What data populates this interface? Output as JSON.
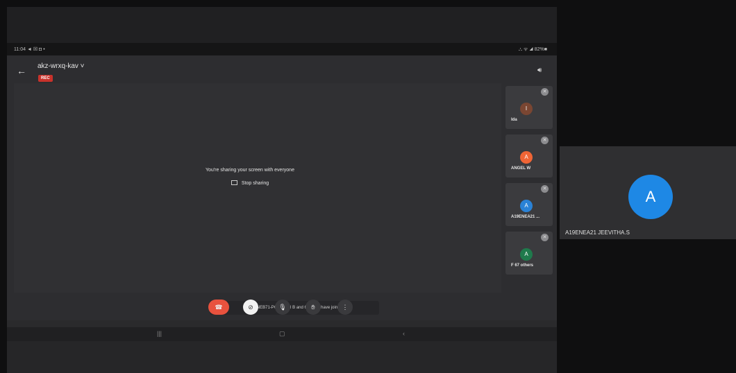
{
  "status_bar": {
    "time": "11:04 ◄ ☒ ◘ •",
    "right": "⛬ ᯤ ◢ 82%■"
  },
  "meeting": {
    "code": "akz-wrxq-kav ˅",
    "rec_label": "REC",
    "sharing_message": "You're sharing your screen with everyone",
    "stop_sharing_label": "Stop sharing",
    "joined_toast": "A19ENEB71-POOVIZHI B and 67 more have joined"
  },
  "participants": [
    {
      "initial": "I",
      "name": "Ida",
      "color": "#7a4632"
    },
    {
      "initial": "A",
      "name": "ANGEL W",
      "color": "#f06535"
    },
    {
      "initial": "A",
      "name": "A19ENEA21 ...",
      "color": "#2a82d6"
    },
    {
      "initial": "A",
      "name": "F  67 others",
      "color": "#1f7a4c"
    }
  ],
  "controls": {
    "end_call_icon": "end-call",
    "camera_icon": "camera-off",
    "mic_icon": "microphone",
    "hand_icon": "raise-hand",
    "more_icon": "more-vertical"
  },
  "right_panel": {
    "initial": "A",
    "name": "A19ENEA21 JEEVITHA.S",
    "avatar_color": "#1e88e5"
  },
  "colors": {
    "end_call": "#e8523e",
    "camera_btn": "#f2f2f2"
  }
}
